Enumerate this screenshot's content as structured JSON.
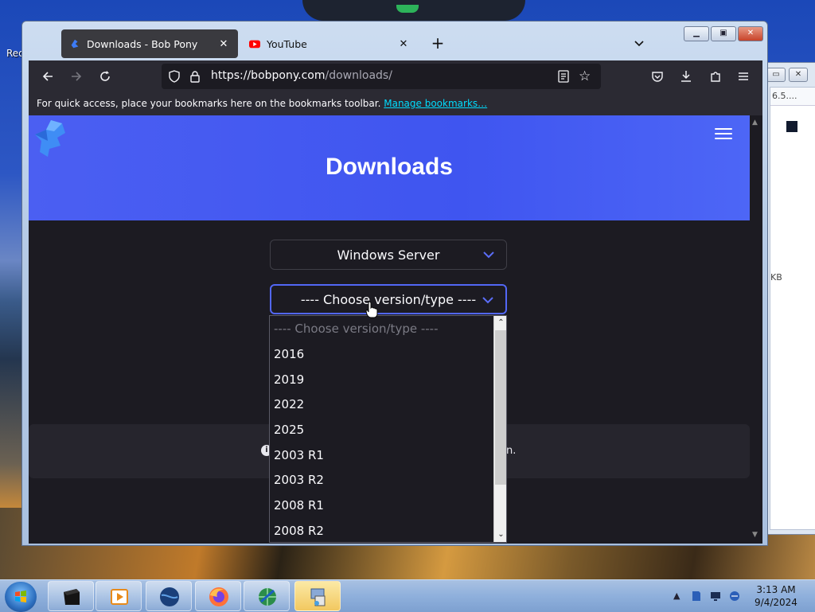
{
  "desktop": {
    "icon_label": "Rec"
  },
  "background_window": {
    "address_text": "6.5....",
    "kb_text": "KB"
  },
  "browser": {
    "tabs": [
      {
        "label": "Downloads - Bob Pony",
        "active": true
      },
      {
        "label": "YouTube",
        "active": false
      }
    ],
    "url_host": "https://bobpony.com",
    "url_path": "/downloads/",
    "bookmarks_message": "For quick access, place your bookmarks here on the bookmarks toolbar.",
    "bookmarks_link": "Manage bookmarks…"
  },
  "page": {
    "title": "Downloads",
    "os_select_value": "Windows Server",
    "version_select_value": "---- Choose version/type ----",
    "info_tail": "n."
  },
  "dropdown": {
    "options": [
      "---- Choose version/type ----",
      "2016",
      "2019",
      "2022",
      "2025",
      "2003 R1",
      "2003 R2",
      "2008 R1",
      "2008 R2"
    ]
  },
  "taskbar": {
    "time": "3:13 AM",
    "date": "9/4/2024"
  },
  "colors": {
    "hero_blue": "#4b5ff2",
    "accent_link": "#00ddff",
    "page_bg": "#1c1b22"
  }
}
